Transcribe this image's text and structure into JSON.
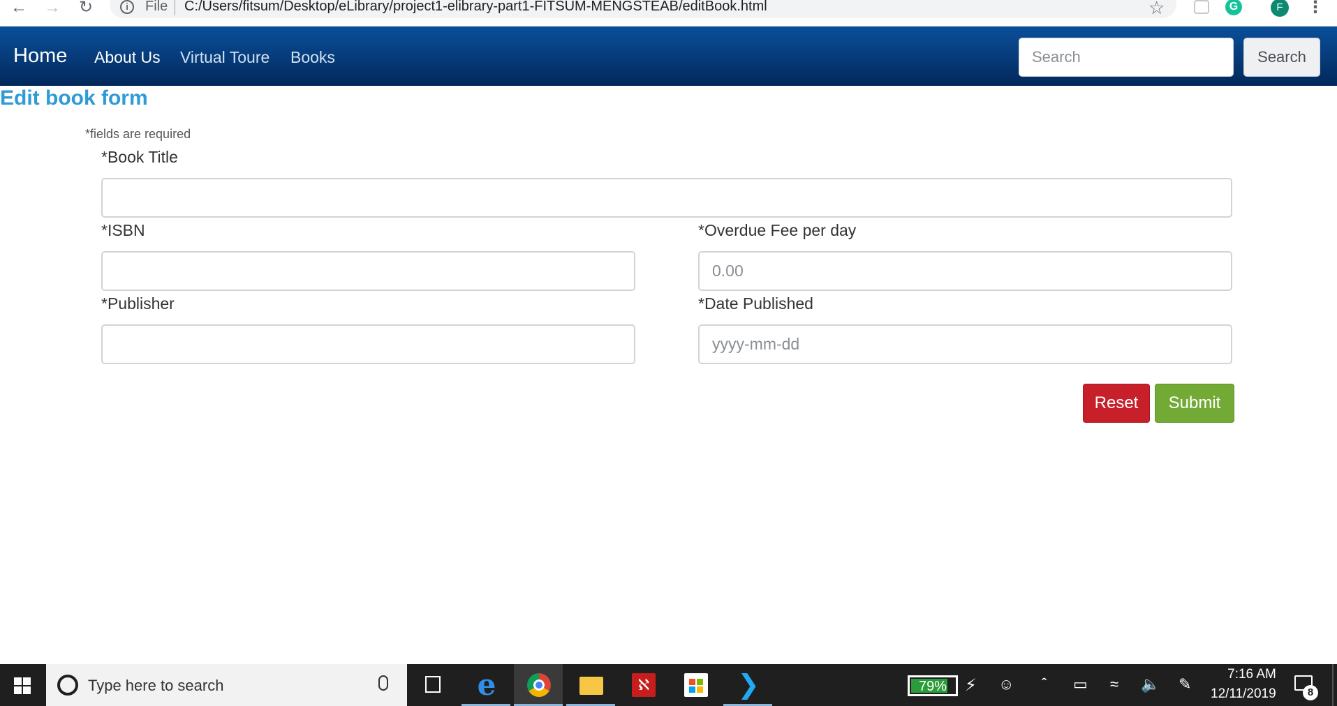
{
  "browser": {
    "scheme_label": "File",
    "url": "C:/Users/fitsum/Desktop/eLibrary/project1-elibrary-part1-FITSUM-MENGSTEAB/editBook.html",
    "profile_initial": "F",
    "grammarly_letter": "G"
  },
  "navbar": {
    "brand": "Home",
    "links": [
      "About Us",
      "Virtual Toure",
      "Books"
    ],
    "search_placeholder": "Search",
    "search_button": "Search"
  },
  "form": {
    "title": "Edit book form",
    "required_note": "*fields are required",
    "fields": {
      "book_title": {
        "label": "*Book Title",
        "value": "",
        "placeholder": ""
      },
      "isbn": {
        "label": "*ISBN",
        "value": "",
        "placeholder": ""
      },
      "overdue_fee": {
        "label": "*Overdue Fee per day",
        "value": "",
        "placeholder": "0.00"
      },
      "publisher": {
        "label": "*Publisher",
        "value": "",
        "placeholder": ""
      },
      "date_published": {
        "label": "*Date Published",
        "value": "",
        "placeholder": "yyyy-mm-dd"
      }
    },
    "reset_label": "Reset",
    "submit_label": "Submit"
  },
  "taskbar": {
    "search_placeholder": "Type here to search",
    "battery_percent": "79%",
    "time": "7:16 AM",
    "date": "12/11/2019",
    "notification_count": "8",
    "acrobat_glyph": "ℵ",
    "apps": [
      "task-view",
      "edge",
      "chrome",
      "file-explorer",
      "acrobat",
      "store",
      "vscode"
    ]
  },
  "colors": {
    "navbar": "#063a78",
    "title": "#2e9bd6",
    "reset": "#c8202a",
    "submit": "#73aa36"
  }
}
